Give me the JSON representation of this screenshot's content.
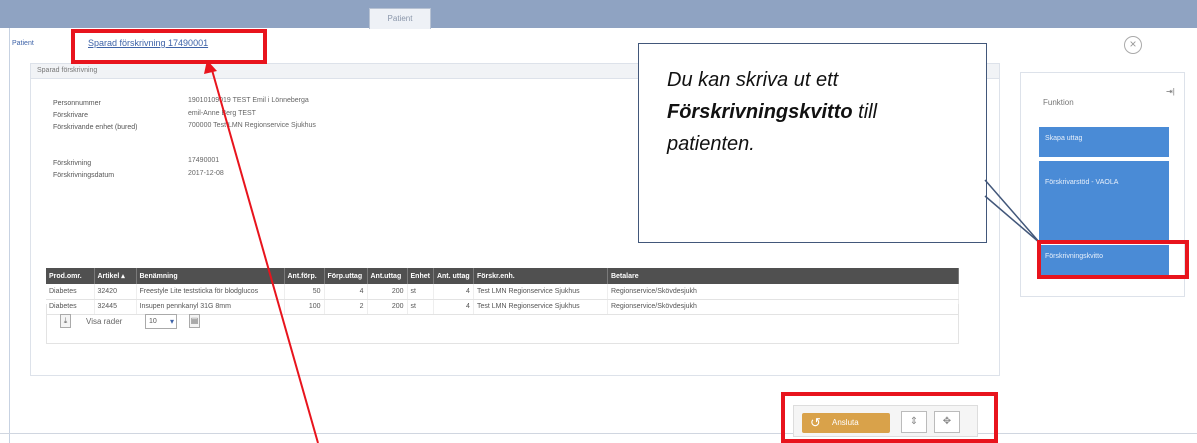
{
  "header": {
    "tab_label": "Patient"
  },
  "breadcrumb": {
    "small_label": "Patient",
    "link": "Sparad förskrivning 17490001"
  },
  "card": {
    "title": "Sparad förskrivning",
    "patient_info": [
      {
        "label": "Personnummer",
        "value": "19010109019 TEST Emil i Lönneberga"
      },
      {
        "label": "Förskrivare",
        "value": "emil-Anne Berg TEST"
      },
      {
        "label": "Förskrivande enhet (bured)",
        "value": "700000 Test LMN Regionservice Sjukhus"
      }
    ],
    "prescription_info": [
      {
        "label": "Förskrivning",
        "value": "17490001"
      },
      {
        "label": "Förskrivningsdatum",
        "value": "2017-12-08"
      }
    ],
    "table": {
      "columns": [
        "Prod.omr.",
        "Artikel",
        "Benämning",
        "Ant.förp.",
        "Förp.uttag",
        "Ant.uttag",
        "Enhet",
        "Ant. uttag",
        "Förskr.enh.",
        "Betalare"
      ],
      "rows": [
        [
          "Diabetes",
          "32420",
          "Freestyle Lite teststicka för blodglucos",
          "50",
          "4",
          "200",
          "st",
          "4",
          "Test LMN Regionservice Sjukhus",
          "Regionservice/Skövdesjukh"
        ],
        [
          "Diabetes",
          "32445",
          "Insupen pennkanyl 31G 8mm",
          "100",
          "2",
          "200",
          "st",
          "4",
          "Test LMN Regionservice Sjukhus",
          "Regionservice/Skövdesjukh"
        ]
      ]
    },
    "pager": {
      "show_rows_label": "Visa rader",
      "rows_value": "10"
    }
  },
  "function_panel": {
    "title": "Funktion",
    "buttons": [
      "Skapa uttag",
      "Förskrivarstöd - VAOLA",
      "Förskrivningskvitto"
    ]
  },
  "callout": {
    "line1": "Du kan skriva ut ett",
    "bold": "Förskrivningskvitto",
    "rest": " till",
    "line3": "patienten."
  },
  "bottom_toolbar": {
    "undo_label": "Ansluta"
  },
  "colors": {
    "topbar": "#8fa3c2",
    "link": "#3e63a8",
    "table_header": "#505050",
    "function_button": "#4a8bd6",
    "action_button": "#d9a24a",
    "annotation_red": "#e8141d"
  }
}
